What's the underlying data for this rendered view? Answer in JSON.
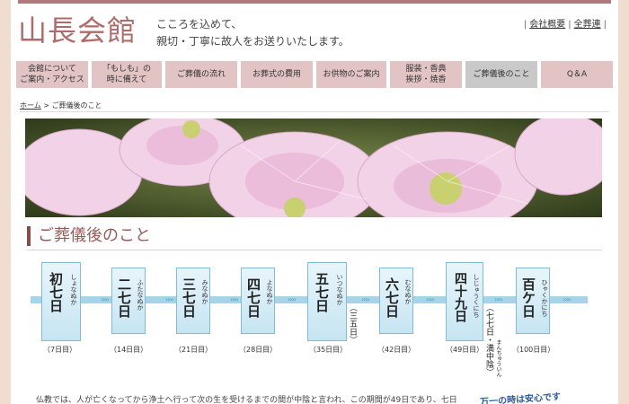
{
  "site": {
    "logo": "山長会館",
    "tagline_1": "こころを込めて、",
    "tagline_2": "親切・丁寧に故人をお送りいたします。"
  },
  "toplinks": [
    {
      "label": "会社概要"
    },
    {
      "label": "全葬連"
    }
  ],
  "nav": [
    {
      "line1": "会館について",
      "line2": "ご案内・アクセス"
    },
    {
      "line1": "「もしも」の",
      "line2": "時に備えて"
    },
    {
      "line1": "ご葬儀の流れ",
      "line2": ""
    },
    {
      "line1": "お葬式の費用",
      "line2": ""
    },
    {
      "line1": "お供物のご案内",
      "line2": ""
    },
    {
      "line1": "服装・香典",
      "line2": "挨拶・焼香"
    },
    {
      "line1": "ご葬儀後のこと",
      "line2": ""
    },
    {
      "line1": "Q＆A",
      "line2": ""
    }
  ],
  "breadcrumb": {
    "home": "ホーム",
    "separator": " > ",
    "current": "ご葬儀後のこと"
  },
  "page_title": "ご葬儀後のこと",
  "memorial_days": [
    {
      "title": "初七日",
      "ruby": "しょなぬか",
      "day": "（7日目）"
    },
    {
      "title": "二七日",
      "ruby": "ふたなぬか",
      "day": "（14日目）"
    },
    {
      "title": "三七日",
      "ruby": "みなぬか",
      "day": "（21日目）"
    },
    {
      "title": "四七日",
      "ruby": "よなぬか",
      "day": "（28日目）"
    },
    {
      "title": "五七日",
      "ruby": "いつなぬか",
      "day": "（35日目）",
      "note": "（三五日）"
    },
    {
      "title": "六七日",
      "ruby": "むなぬか",
      "day": "（42日目）"
    },
    {
      "title": "四十九日",
      "ruby": "しじゅうくにち",
      "day": "（49日目）",
      "note": "（七七日・満中陰）",
      "note_ruby": "まんちゅういん"
    },
    {
      "title": "百ケ日",
      "ruby": "ひゃくかにち",
      "day": "（100日目）"
    }
  ],
  "arrows": "››››",
  "body_text": "仏教では、人が亡くなってから浄土へ行って次の生を受けるまでの間が中陰と言われ、この期間が49日であり、七日",
  "promo_text": "万一の時は安心です",
  "colors": {
    "accent": "#b06a6a",
    "nav_bg": "#e3c4c4",
    "nav_active": "#c9c9c9",
    "timeline": "#a6d5ea"
  }
}
